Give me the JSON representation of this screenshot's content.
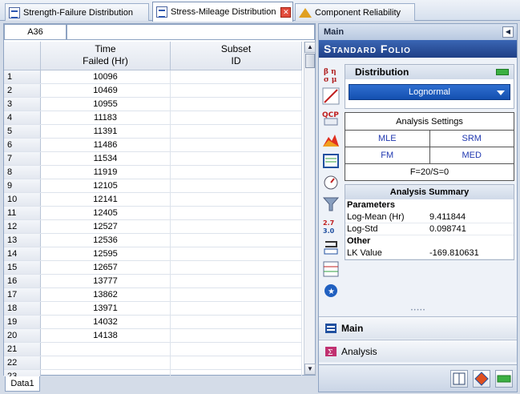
{
  "tabs": [
    {
      "label": "Strength-Failure Distribution",
      "active": false
    },
    {
      "label": "Stress-Mileage Distribution",
      "active": true
    },
    {
      "label": "Component Reliability",
      "active": false
    }
  ],
  "cell_ref": "A36",
  "columns": [
    {
      "line1": "Time",
      "line2": "Failed (Hr)"
    },
    {
      "line1": "Subset",
      "line2": "ID"
    }
  ],
  "rows": [
    {
      "n": "1",
      "time": "10096"
    },
    {
      "n": "2",
      "time": "10469"
    },
    {
      "n": "3",
      "time": "10955"
    },
    {
      "n": "4",
      "time": "11183"
    },
    {
      "n": "5",
      "time": "11391"
    },
    {
      "n": "6",
      "time": "11486"
    },
    {
      "n": "7",
      "time": "11534"
    },
    {
      "n": "8",
      "time": "11919"
    },
    {
      "n": "9",
      "time": "12105"
    },
    {
      "n": "10",
      "time": "12141"
    },
    {
      "n": "11",
      "time": "12405"
    },
    {
      "n": "12",
      "time": "12527"
    },
    {
      "n": "13",
      "time": "12536"
    },
    {
      "n": "14",
      "time": "12595"
    },
    {
      "n": "15",
      "time": "12657"
    },
    {
      "n": "16",
      "time": "13777"
    },
    {
      "n": "17",
      "time": "13862"
    },
    {
      "n": "18",
      "time": "13971"
    },
    {
      "n": "19",
      "time": "14032"
    },
    {
      "n": "20",
      "time": "14138"
    },
    {
      "n": "21",
      "time": ""
    },
    {
      "n": "22",
      "time": ""
    },
    {
      "n": "23",
      "time": ""
    }
  ],
  "sheet_tab": "Data1",
  "panel": {
    "header": "Main",
    "banner": "Standard Folio",
    "distribution_label": "Distribution",
    "distribution_value": "Lognormal",
    "settings_title": "Analysis Settings",
    "settings": [
      "MLE",
      "SRM",
      "FM",
      "MED"
    ],
    "settings_footer": "F=20/S=0",
    "summary_title": "Analysis Summary",
    "parameters_label": "Parameters",
    "log_mean_label": "Log-Mean (Hr)",
    "log_mean_value": "9.411844",
    "log_std_label": "Log-Std",
    "log_std_value": "0.098741",
    "other_label": "Other",
    "lk_label": "LK Value",
    "lk_value": "-169.810631",
    "nav_main": "Main",
    "nav_analysis": "Analysis"
  },
  "colors": {
    "accent": "#1f4fb0",
    "flag": "#3cb043",
    "close": "#e24b3b"
  }
}
